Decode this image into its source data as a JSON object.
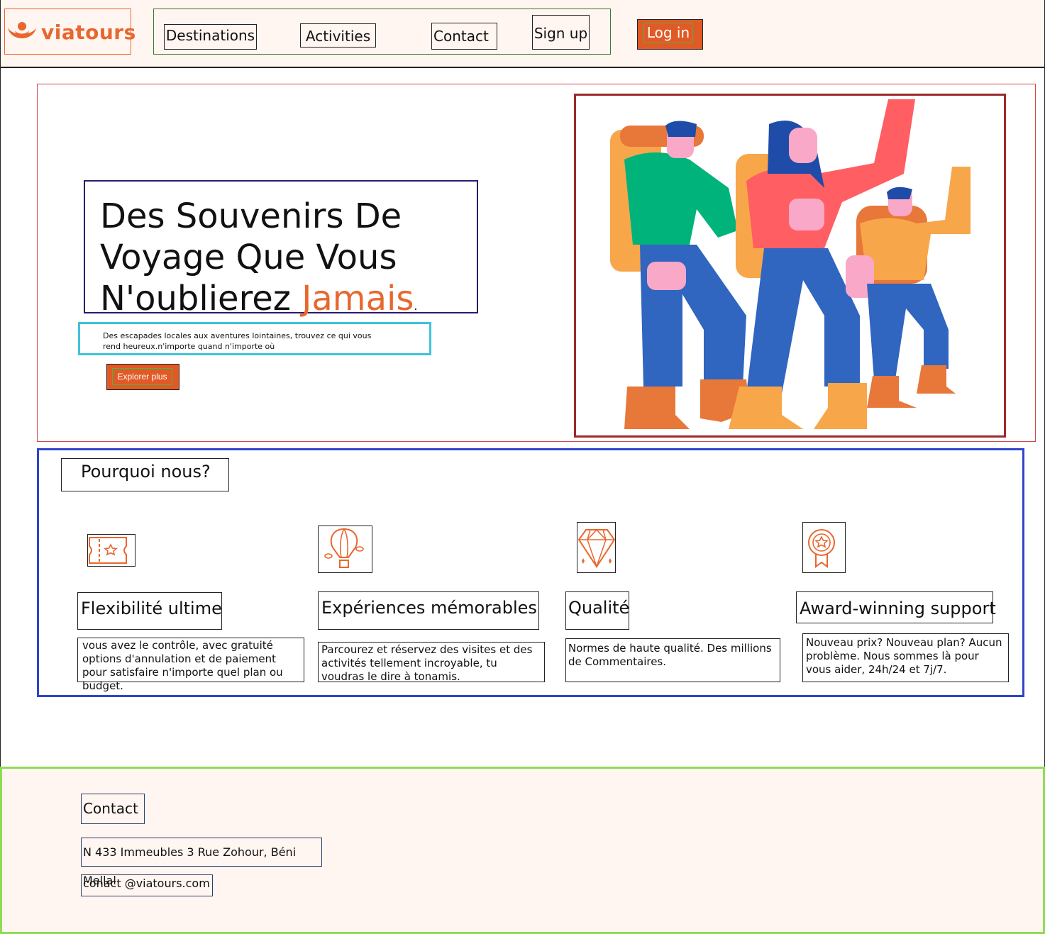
{
  "header": {
    "brand": "viatours",
    "nav": [
      {
        "label": "Destinations"
      },
      {
        "label": "Activities"
      },
      {
        "label": "Contact"
      },
      {
        "label": "Sign up"
      }
    ],
    "login_label": "Log in"
  },
  "hero": {
    "title_line1": "Des Souvenirs De",
    "title_line2": "Voyage Que Vous",
    "title_line3_prefix": "N'oublierez ",
    "title_accent": "Jamais",
    "title_suffix": ".",
    "subtitle_line1": "Des escapades locales aux aventures lointaines, trouvez ce qui vous",
    "subtitle_line2": "rend heureux.n'importe quand n'importe où",
    "cta_label": "Explorer plus"
  },
  "features": {
    "title": "Pourquoi nous?",
    "items": [
      {
        "icon": "ticket-icon",
        "title": "Flexibilité ultime",
        "description": "vous avez le contrôle, avec gratuité options d'annulation et de paiement pour satisfaire n'importe quel plan ou budget."
      },
      {
        "icon": "hot-air-balloon-icon",
        "title": "Expériences mémorables",
        "description": "Parcourez et réservez des visites et des activités tellement incroyable, tu voudras le dire à tonamis."
      },
      {
        "icon": "diamond-icon",
        "title": "Qualité",
        "description": "Normes de haute qualité. Des millions de Commentaires."
      },
      {
        "icon": "award-medal-icon",
        "title": "Award-winning support",
        "description": "Nouveau prix? Nouveau plan? Aucun problème. Nous sommes là pour vous aider, 24h/24 et 7j/7."
      }
    ]
  },
  "footer": {
    "title": "Contact",
    "address": "N 433 Immeubles 3 Rue Zohour, Béni Mellal",
    "email": "conact @viatours.com"
  },
  "colors": {
    "accent": "#e8672f",
    "button": "#e15a26",
    "header_bg": "#fff5f1",
    "hero_border": "#d64545",
    "features_border": "#2e45c8",
    "footer_border": "#8edc54"
  }
}
